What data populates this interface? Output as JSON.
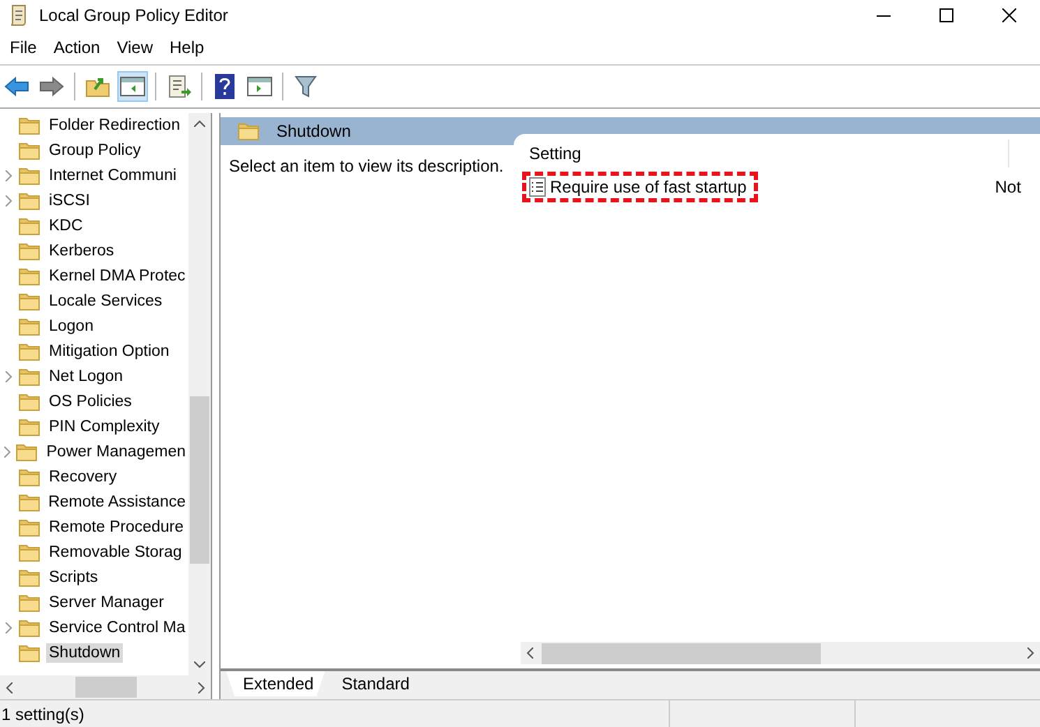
{
  "window": {
    "title": "Local Group Policy Editor"
  },
  "menu": [
    "File",
    "Action",
    "View",
    "Help"
  ],
  "toolbar": {
    "show_tree_pressed": true
  },
  "tree": {
    "items": [
      {
        "label": "Folder Redirection",
        "expandable": false,
        "selected": false
      },
      {
        "label": "Group Policy",
        "expandable": false,
        "selected": false
      },
      {
        "label": "Internet Communi",
        "expandable": true,
        "selected": false
      },
      {
        "label": "iSCSI",
        "expandable": true,
        "selected": false
      },
      {
        "label": "KDC",
        "expandable": false,
        "selected": false
      },
      {
        "label": "Kerberos",
        "expandable": false,
        "selected": false
      },
      {
        "label": "Kernel DMA Protec",
        "expandable": false,
        "selected": false
      },
      {
        "label": "Locale Services",
        "expandable": false,
        "selected": false
      },
      {
        "label": "Logon",
        "expandable": false,
        "selected": false
      },
      {
        "label": "Mitigation Option",
        "expandable": false,
        "selected": false
      },
      {
        "label": "Net Logon",
        "expandable": true,
        "selected": false
      },
      {
        "label": "OS Policies",
        "expandable": false,
        "selected": false
      },
      {
        "label": "PIN Complexity",
        "expandable": false,
        "selected": false
      },
      {
        "label": "Power Managemen",
        "expandable": true,
        "selected": false
      },
      {
        "label": "Recovery",
        "expandable": false,
        "selected": false
      },
      {
        "label": "Remote Assistance",
        "expandable": false,
        "selected": false
      },
      {
        "label": "Remote Procedure",
        "expandable": false,
        "selected": false
      },
      {
        "label": "Removable Storag",
        "expandable": false,
        "selected": false
      },
      {
        "label": "Scripts",
        "expandable": false,
        "selected": false
      },
      {
        "label": "Server Manager",
        "expandable": false,
        "selected": false
      },
      {
        "label": "Service Control Ma",
        "expandable": true,
        "selected": false
      },
      {
        "label": "Shutdown",
        "expandable": false,
        "selected": true
      }
    ]
  },
  "detail": {
    "header": "Shutdown",
    "description": "Select an item to view its description.",
    "table": {
      "columns": [
        "Setting"
      ],
      "rows": [
        {
          "setting": "Require use of fast startup",
          "column_2": "Not",
          "highlighted": true
        }
      ]
    }
  },
  "view_tabs": [
    {
      "label": "Extended",
      "selected": true
    },
    {
      "label": "Standard",
      "selected": false
    }
  ],
  "status_bar": {
    "text": "1 setting(s)"
  }
}
